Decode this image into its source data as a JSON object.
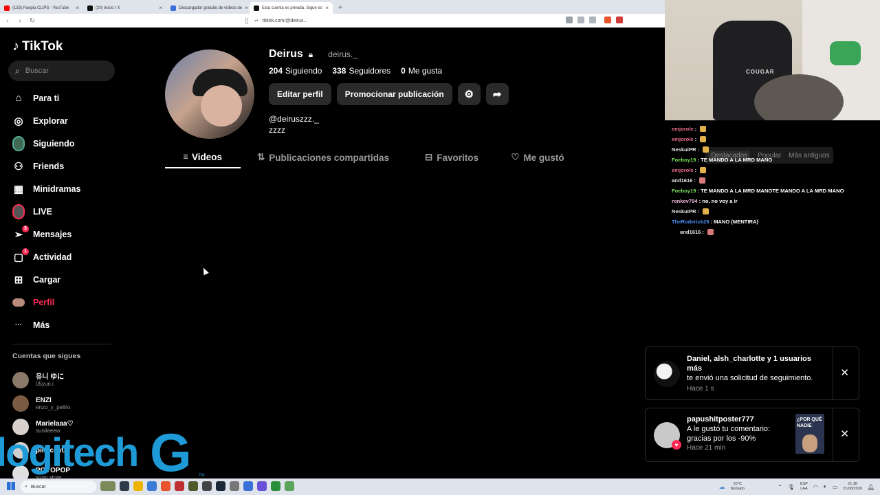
{
  "browser": {
    "tabs": [
      {
        "title": "(133) Pueplu CLIPS - YouTube",
        "color": "#ff0000"
      },
      {
        "title": "(20) Inicio / X",
        "color": "#000000"
      },
      {
        "title": "Descargador gratuito de vídeos de",
        "color": "#3b6fd8"
      },
      {
        "title": "Esta cuenta es privada. Sigue es",
        "color": "#000000",
        "active": true
      }
    ],
    "new_tab": "+",
    "url": "tiktok.com/@deirus..."
  },
  "tiktok": {
    "logo": "TikTok",
    "search_placeholder": "Buscar",
    "nav": [
      {
        "label": "Para ti",
        "icon": "home-icon",
        "glyph": "⌂"
      },
      {
        "label": "Explorar",
        "icon": "compass-icon",
        "glyph": "◎"
      },
      {
        "label": "Siguiendo",
        "icon": "following-avatar-icon",
        "glyph": "●"
      },
      {
        "label": "Friends",
        "icon": "friends-icon",
        "glyph": "⚇"
      },
      {
        "label": "Minidramas",
        "icon": "minidramas-icon",
        "glyph": "▦"
      },
      {
        "label": "LIVE",
        "icon": "live-icon",
        "glyph": "●"
      },
      {
        "label": "Mensajes",
        "icon": "messages-icon",
        "glyph": "➢",
        "badge": "3"
      },
      {
        "label": "Actividad",
        "icon": "activity-icon",
        "glyph": "▢",
        "badge": "1"
      },
      {
        "label": "Cargar",
        "icon": "upload-icon",
        "glyph": "⊞"
      },
      {
        "label": "Perfil",
        "icon": "profile-avatar-icon",
        "glyph": "●"
      },
      {
        "label": "Más",
        "icon": "more-icon",
        "glyph": "···"
      }
    ],
    "following_title": "Cuentas que sigues",
    "following": [
      {
        "name": "유니 ゆに",
        "handle": "05yun.i"
      },
      {
        "name": "ENZI",
        "handle": "enzo_y_peltro"
      },
      {
        "name": "Marielaaa♡",
        "handle": "suniieeew"
      },
      {
        "name": "pinkcityu",
        "handle": ""
      },
      {
        "name": "POYOPOP",
        "handle": "soop.store"
      }
    ],
    "profile": {
      "name": "Deirus",
      "handle_alt": "deirus._",
      "stats": [
        {
          "num": "204",
          "label": "Siguiendo"
        },
        {
          "num": "338",
          "label": "Seguidores"
        },
        {
          "num": "0",
          "label": "Me gusta"
        }
      ],
      "edit_label": "Editar perfil",
      "promote_label": "Promocionar publicación",
      "username": "@deiruszzz._",
      "bio": "zzzz",
      "tabs": [
        {
          "label": "Videos",
          "glyph": "⦙⦙⦙"
        },
        {
          "label": "Publicaciones compartidas",
          "glyph": "⇅"
        },
        {
          "label": "Favoritos",
          "glyph": "⊟"
        },
        {
          "label": "Me gustó",
          "glyph": "♡"
        }
      ]
    }
  },
  "chat": {
    "sort": [
      "Destacados",
      "Popular",
      "Más antiguos"
    ],
    "messages": [
      {
        "user": "emjorole",
        "color": "#e86a8a",
        "text": ":"
      },
      {
        "user": "emjorole",
        "color": "#e86a8a",
        "text": ":"
      },
      {
        "user": "NeskuiPR",
        "color": "#e6e6e6",
        "text": ":"
      },
      {
        "user": "Foeboy19",
        "color": "#7be35a",
        "text": ": TE MANDO A LA MRD MANO"
      },
      {
        "user": "emjorole",
        "color": "#e86a8a",
        "text": ":"
      },
      {
        "user": "and1616",
        "color": "#e6e6e6",
        "text": ":"
      },
      {
        "user": "Foeboy19",
        "color": "#7be35a",
        "text": ": TE MANDO A LA MRD MANOTE MANDO A LA MRD MANO"
      },
      {
        "user": "ronkev794",
        "color": "#f0b8d8",
        "text": ": no, no voy a ir"
      },
      {
        "user": "NeskuiPR",
        "color": "#e6e6e6",
        "text": ":"
      },
      {
        "user": "TheRoderick29",
        "color": "#4a8cf0",
        "text": ": MANO (MENTIRA)"
      },
      {
        "user": "and1616",
        "color": "#e6e6e6",
        "text": ":"
      }
    ]
  },
  "notifications": [
    {
      "title": "Daniel, alsh_charlotte y 1 usuarios más",
      "body": "te envió una solicitud de seguimiento.",
      "time": "Hace 1 s"
    },
    {
      "title": "papushitposter777",
      "body": "A le gustó tu comentario: gracias por los -90%",
      "time": "Hace 21 min",
      "thumb_text": "¿POR QUÉ NADIE"
    }
  ],
  "overlay": {
    "logi": "logitech",
    "g": "G",
    "tm": "TM"
  },
  "webcam": {
    "brand": "COUGAR"
  },
  "taskbar": {
    "search": "Buscar",
    "weather": "20°C",
    "weather_desc": "Nublado",
    "lang1": "ESP",
    "lang2": "LAA",
    "time": "21:38",
    "date": "21/08/2026",
    "icon_colors": [
      "#7a8a5a",
      "#2f3a48",
      "#f0b400",
      "#3a7bd5",
      "#d04040",
      "#4caf50",
      "#555",
      "#444",
      "#333",
      "#888",
      "#3b6fd8",
      "#6a4fd8",
      "#2a8f3a",
      "#5aa35a"
    ]
  }
}
